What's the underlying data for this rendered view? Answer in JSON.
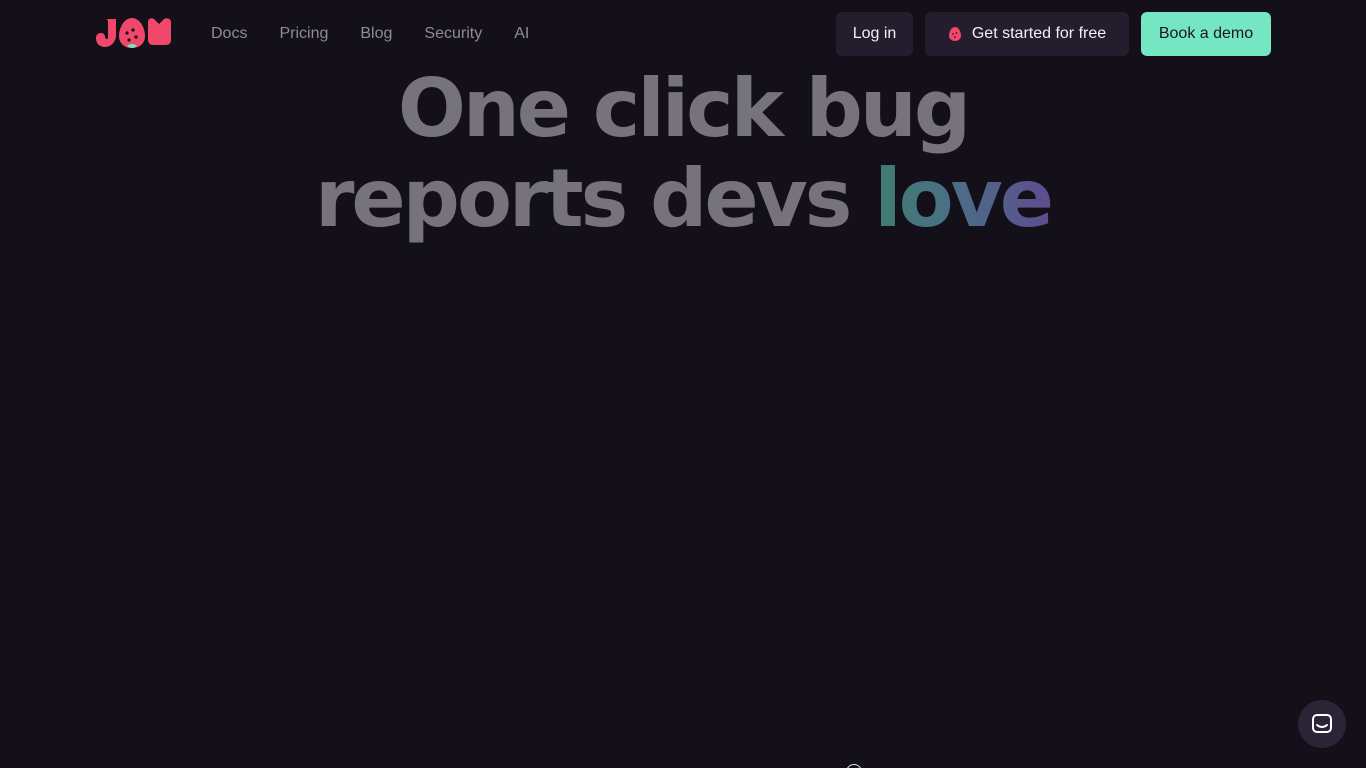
{
  "brand": {
    "logo_icon": "jam-logo",
    "logo_color": "#f0476a",
    "leaf_color": "#74e6c2"
  },
  "nav": {
    "items": [
      {
        "label": "Docs"
      },
      {
        "label": "Pricing"
      },
      {
        "label": "Blog"
      },
      {
        "label": "Security"
      },
      {
        "label": "AI"
      }
    ]
  },
  "header_actions": {
    "login_label": "Log in",
    "start_label": "Get started for free",
    "start_icon": "strawberry-icon",
    "demo_label": "Book a demo",
    "demo_color": "#74e6c2"
  },
  "hero": {
    "line1": "One click bug",
    "line2_prefix": "reports devs",
    "line2_highlight": "love"
  },
  "chat": {
    "icon": "chat-bubble-icon"
  },
  "colors": {
    "background": "#13101a",
    "headline": "#76737d",
    "nav_text": "#8e8a9a",
    "button_dark": "#231d2e"
  }
}
